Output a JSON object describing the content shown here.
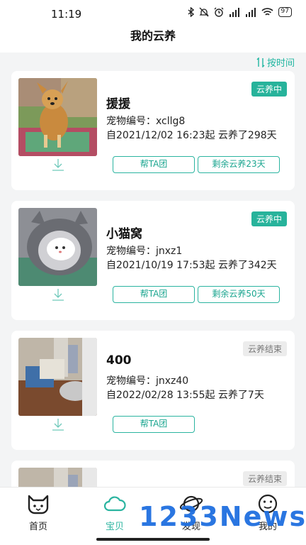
{
  "status": {
    "time": "11:19",
    "battery": "97"
  },
  "header": {
    "title": "我的云养"
  },
  "sort": {
    "label": "按时间"
  },
  "pets": [
    {
      "name": "援援",
      "id_label": "宠物编号：",
      "id": "xcllg8",
      "since": "自2021/12/02 16:23起 云养了298天",
      "badge": "云养中",
      "help": "帮TA团",
      "remain": "剩余云养23天"
    },
    {
      "name": "小猫窝",
      "id_label": "宠物编号：",
      "id": "jnxz1",
      "since": "自2021/10/19 17:53起 云养了342天",
      "badge": "云养中",
      "help": "帮TA团",
      "remain": "剩余云养50天"
    },
    {
      "name": "400",
      "id_label": "宠物编号：",
      "id": "jnxz40",
      "since": "自2022/02/28 13:55起 云养了7天",
      "badge": "云养结束",
      "help": "帮TA团"
    },
    {
      "badge": "云养结束"
    }
  ],
  "tabs": [
    {
      "label": "首页",
      "icon": "cat-face-icon"
    },
    {
      "label": "宝贝",
      "icon": "cloud-icon"
    },
    {
      "label": "发现",
      "icon": "planet-icon"
    },
    {
      "label": "我的",
      "icon": "smile-face-icon"
    }
  ],
  "watermark": "1233News",
  "colors": {
    "accent": "#27b39b",
    "ended_badge": "#ececec"
  }
}
